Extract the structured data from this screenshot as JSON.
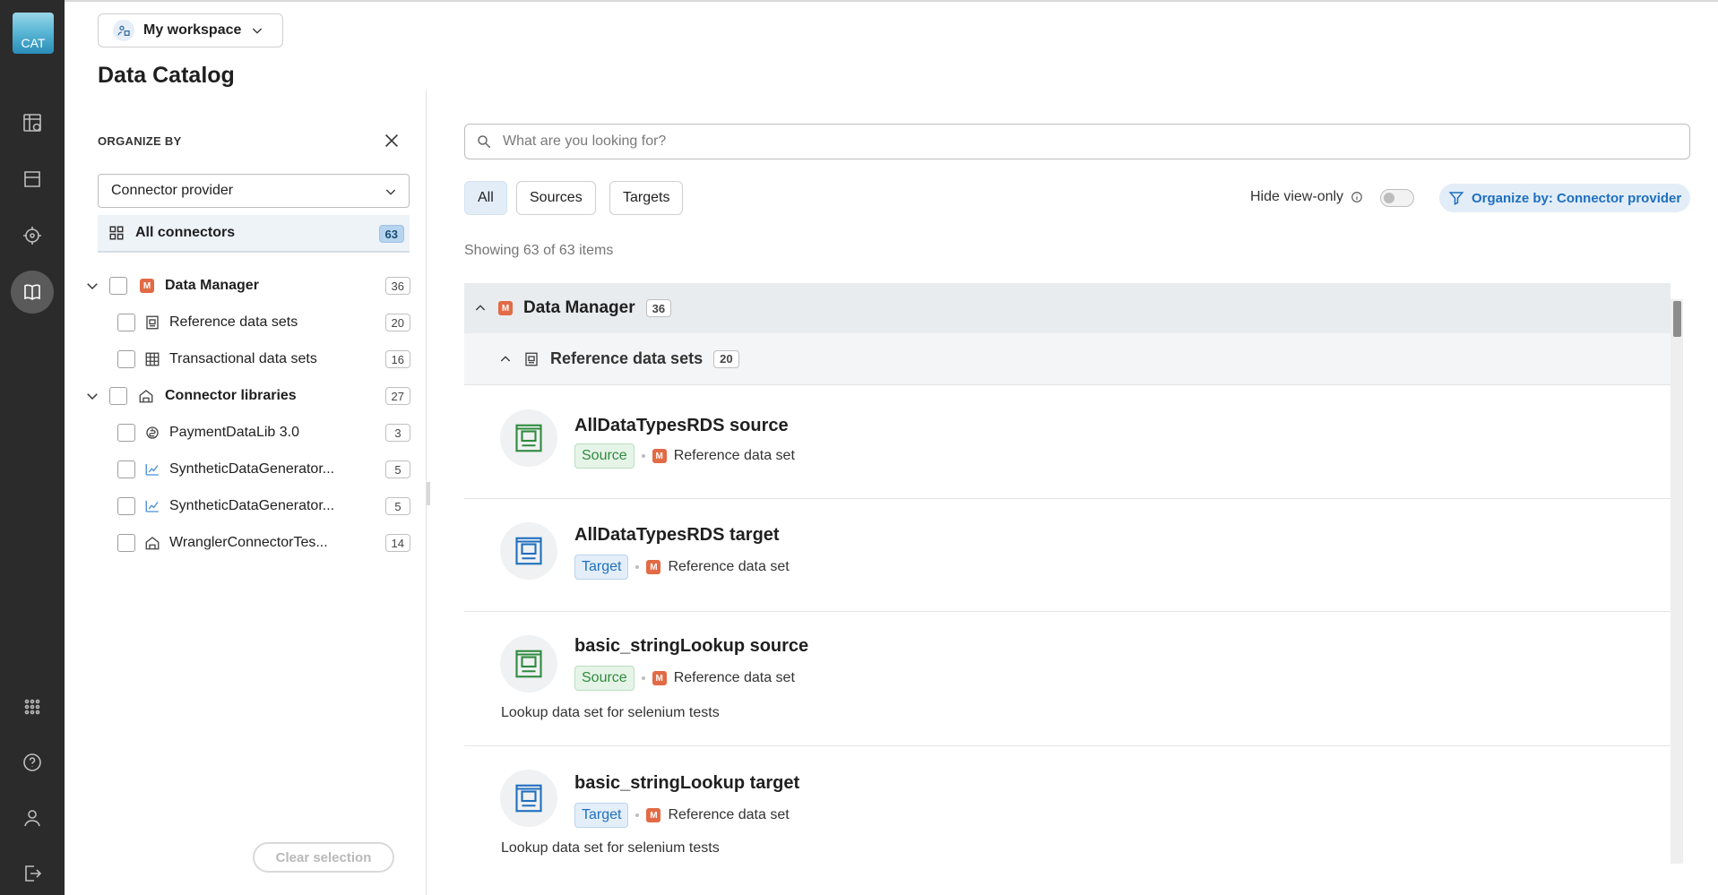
{
  "app": {
    "logo_text": "CAT"
  },
  "rail": {
    "items": [
      {
        "icon": "table-icon"
      },
      {
        "icon": "folder-icon"
      },
      {
        "icon": "crosshair-icon"
      },
      {
        "icon": "book-icon",
        "active": true
      }
    ],
    "bottom": [
      {
        "icon": "apps-grid-icon"
      },
      {
        "icon": "help-icon"
      },
      {
        "icon": "user-icon"
      },
      {
        "icon": "logout-icon"
      }
    ]
  },
  "header": {
    "workspace_label": "My workspace",
    "page_title": "Data Catalog"
  },
  "left_panel": {
    "organize_label": "ORGANIZE BY",
    "select_value": "Connector provider",
    "all_connectors": {
      "label": "All connectors",
      "count": "63"
    },
    "groups": [
      {
        "label": "Data Manager",
        "count": "36",
        "children": [
          {
            "label": "Reference data sets",
            "count": "20"
          },
          {
            "label": "Transactional data sets",
            "count": "16"
          }
        ]
      },
      {
        "label": "Connector libraries",
        "count": "27",
        "children": [
          {
            "label": "PaymentDataLib 3.0",
            "count": "3"
          },
          {
            "label": "SyntheticDataGenerator...",
            "count": "5"
          },
          {
            "label": "SyntheticDataGenerator...",
            "count": "5"
          },
          {
            "label": "WranglerConnectorTes...",
            "count": "14"
          }
        ]
      }
    ],
    "clear_label": "Clear selection"
  },
  "main": {
    "search_placeholder": "What are you looking for?",
    "filters": [
      "All",
      "Sources",
      "Targets"
    ],
    "hide_view_only": "Hide view-only",
    "organize_by": "Organize by: Connector provider",
    "showing": "Showing 63 of 63 items",
    "group": {
      "label": "Data Manager",
      "count": "36"
    },
    "subgroup": {
      "label": "Reference data sets",
      "count": "20"
    },
    "items": [
      {
        "name": "AllDataTypesRDS source",
        "tag": "Source",
        "kind": "Reference data set",
        "description": ""
      },
      {
        "name": "AllDataTypesRDS target",
        "tag": "Target",
        "kind": "Reference data set",
        "description": ""
      },
      {
        "name": "basic_stringLookup source",
        "tag": "Source",
        "kind": "Reference data set",
        "description": "Lookup data set for selenium tests"
      },
      {
        "name": "basic_stringLookup target",
        "tag": "Target",
        "kind": "Reference data set",
        "description": "Lookup data set for selenium tests"
      }
    ]
  },
  "colors": {
    "source_green": "#2e8b3e",
    "target_blue": "#1e6fbf",
    "manager_orange": "#e26a45",
    "rail_bg": "#2b2b2b"
  }
}
